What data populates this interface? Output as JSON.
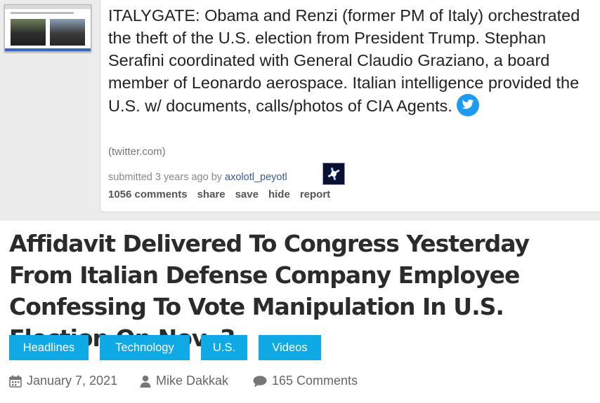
{
  "post": {
    "title": "ITALYGATE: Obama and Renzi (former PM of Italy) orchestrated the theft of the U.S. election from President Trump. Stephan Serafini coordinated with General Claudio Graziano, a board member of Leonardo aerospace. Italian intelligence provided the U.S. w/ documents, calls/photos of CIA Agents.",
    "domain": "(twitter.com)",
    "submitted_prefix": "submitted 3 years ago by ",
    "author": "axolotl_peyotl",
    "actions": [
      "1056 comments",
      "share",
      "save",
      "hide",
      "report"
    ]
  },
  "article": {
    "headline": "Affidavit Delivered To Congress Yesterday From Italian Defense Company Employee Confessing To Vote Manipulation In U.S. Election On Nov. 3",
    "tags": [
      "Headlines",
      "Technology",
      "U.S.",
      "Videos"
    ],
    "date": "January 7, 2021",
    "author": "Mike Dakkak",
    "comments": "165 Comments"
  },
  "colors": {
    "tag_bg": "#0fa9e6",
    "twitter_blue": "#1d9bf0",
    "author_link": "#3a5a9a"
  },
  "icons": [
    "twitter-bird-icon",
    "calendar-icon",
    "user-icon",
    "comment-icon"
  ]
}
